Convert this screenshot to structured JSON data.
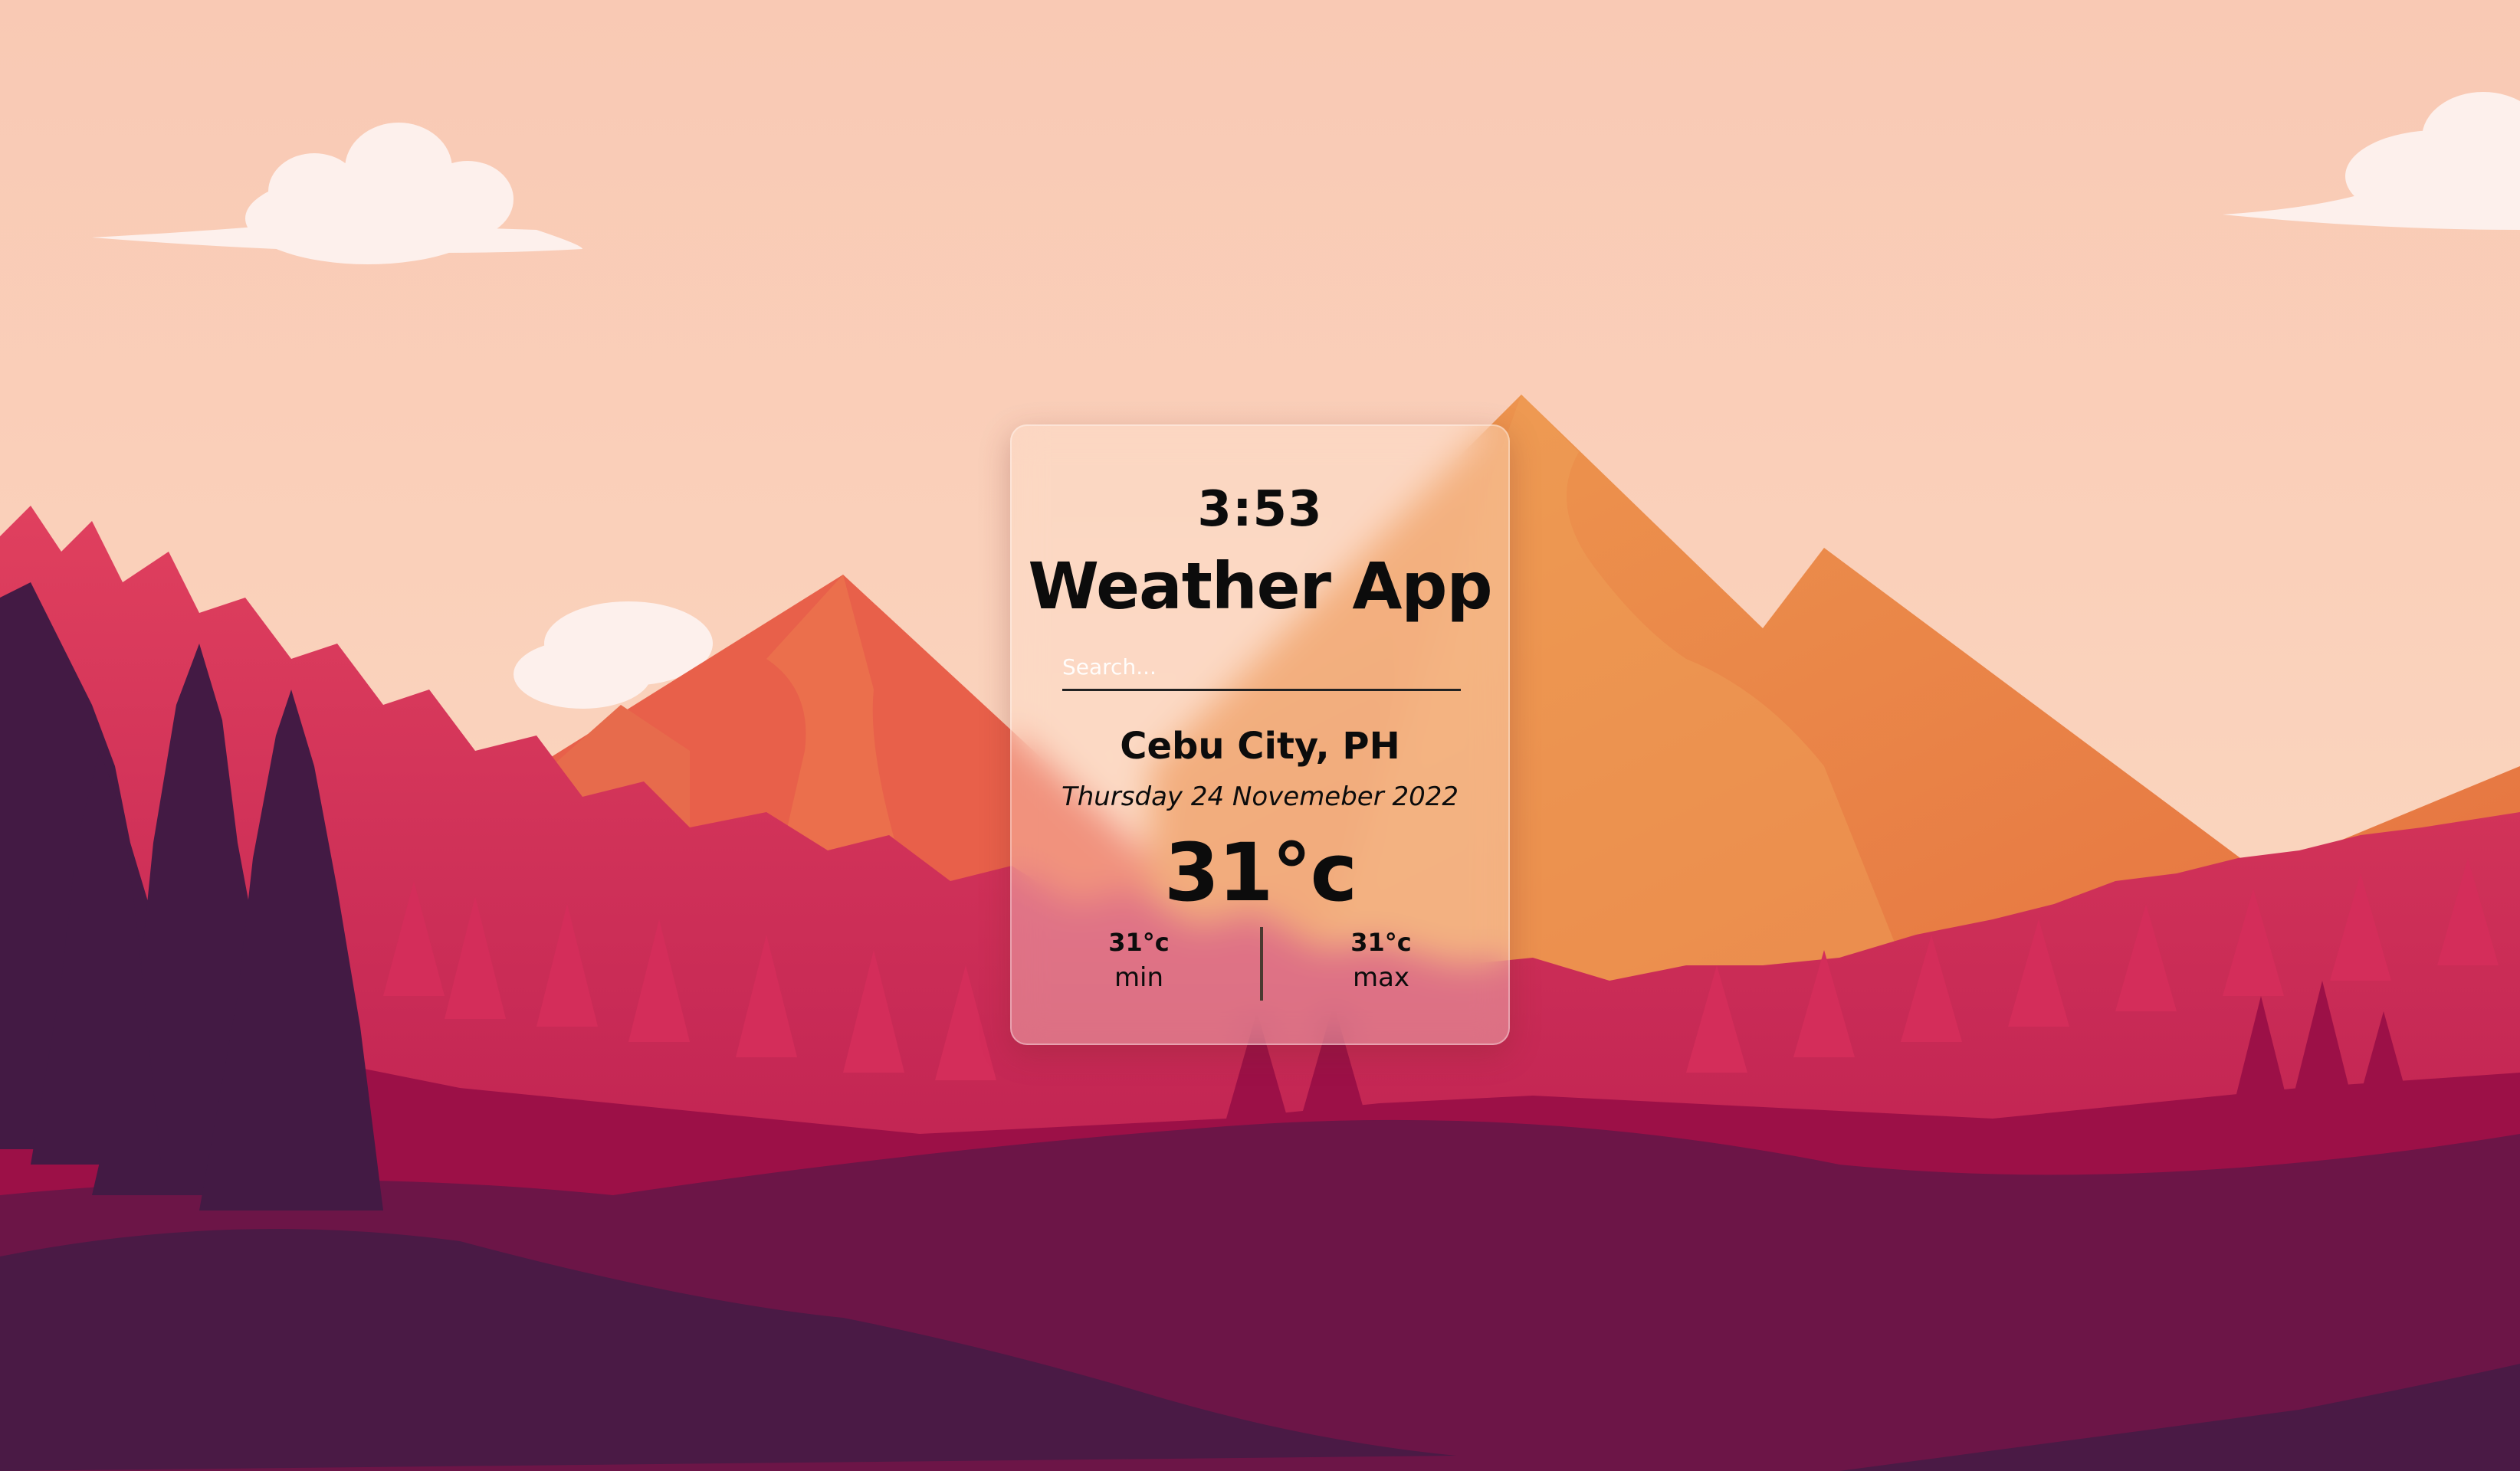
{
  "card": {
    "time": "3:53",
    "title": "Weather App",
    "search_placeholder": "Search...",
    "city": "Cebu City, PH",
    "date": "Thursday 24 Novemeber 2022",
    "temperature": "31°c",
    "min_temp": "31°c",
    "min_label": "min",
    "max_temp": "31°c",
    "max_label": "max"
  },
  "colors": {
    "sky": "#f9cdb8",
    "mountain_orange": "#e98447",
    "mountain_red": "#e65b47",
    "forest_pink": "#d4305a",
    "forest_crimson": "#9c0f47",
    "ground_plum": "#6b1547",
    "foreground_dark": "#421a42",
    "cloud": "#fdf0ec"
  }
}
